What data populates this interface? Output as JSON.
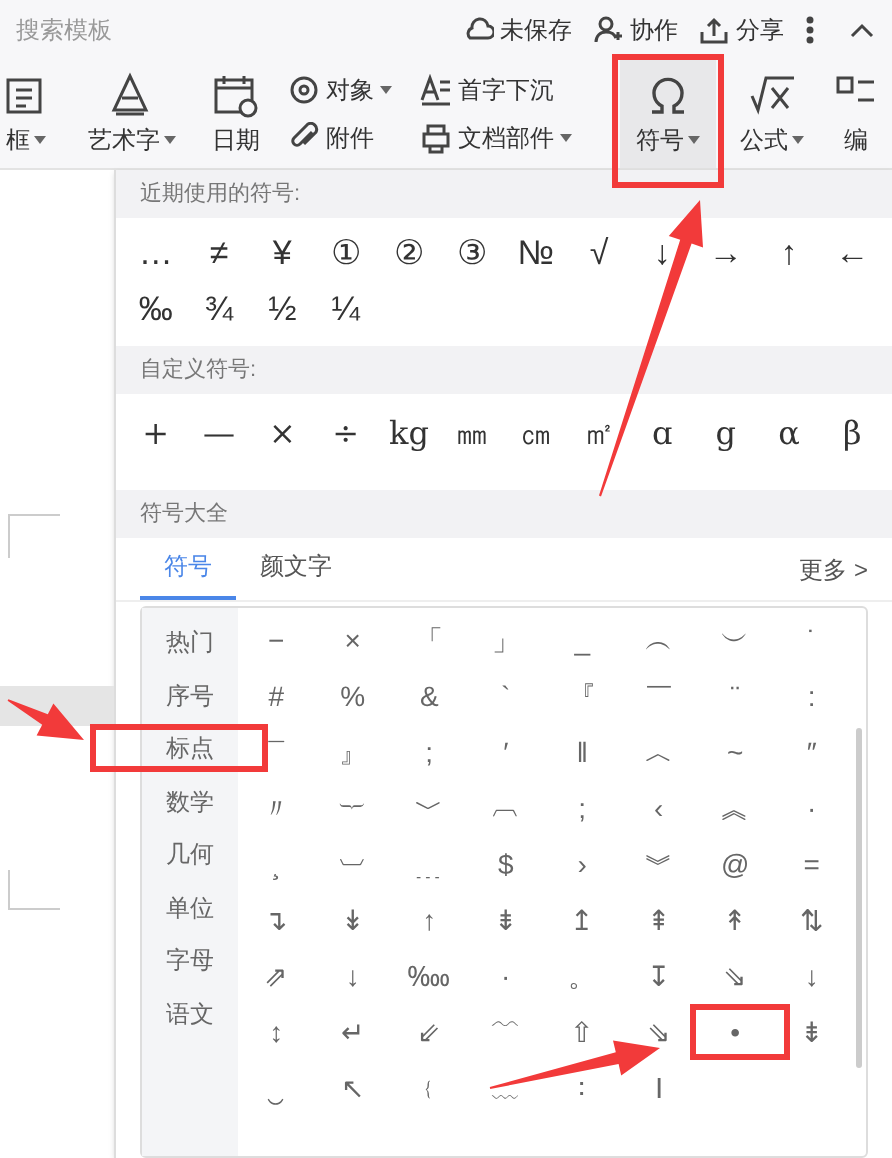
{
  "top_bar": {
    "search": "搜索模板",
    "actions": [
      {
        "label": "未保存"
      },
      {
        "label": "协作"
      },
      {
        "label": "分享"
      }
    ]
  },
  "toolbar": [
    {
      "kind": "large",
      "label": "框",
      "dropdown": true,
      "highlighted": false
    },
    {
      "kind": "large",
      "label": "艺术字",
      "dropdown": true,
      "highlighted": false
    },
    {
      "kind": "large",
      "label": "日期",
      "dropdown": false,
      "highlighted": false
    },
    {
      "kind": "pair",
      "items": [
        {
          "label": "对象",
          "dropdown": true
        },
        {
          "label": "附件",
          "dropdown": false
        }
      ]
    },
    {
      "kind": "pair",
      "items": [
        {
          "label": "首字下沉",
          "dropdown": false
        },
        {
          "label": "文档部件",
          "dropdown": true
        }
      ]
    },
    {
      "kind": "large",
      "label": "符号",
      "dropdown": true,
      "highlighted": true
    },
    {
      "kind": "large",
      "label": "公式",
      "dropdown": true,
      "highlighted": false
    },
    {
      "kind": "large",
      "label": "编",
      "dropdown": false,
      "highlighted": false
    }
  ],
  "symbol_panel": {
    "recent": {
      "title": "近期使用的符号:",
      "symbols": [
        "…",
        "≠",
        "¥",
        "①",
        "②",
        "③",
        "№",
        "√",
        "↓",
        "→",
        "↑",
        "←",
        "‰",
        "¾",
        "½",
        "¼"
      ]
    },
    "custom": {
      "title": "自定义符号:",
      "symbols": [
        "+",
        "—",
        "×",
        "÷",
        "kg",
        "㎜",
        "㎝",
        "㎡",
        "ɑ",
        "g",
        "α",
        "β"
      ]
    },
    "all": {
      "title": "符号大全",
      "tabs": [
        {
          "label": "符号",
          "selected": true
        },
        {
          "label": "颜文字",
          "selected": false
        }
      ],
      "more": "更多 >",
      "categories": [
        {
          "label": "热门",
          "highlighted": false
        },
        {
          "label": "序号",
          "highlighted": false
        },
        {
          "label": "标点",
          "highlighted": true
        },
        {
          "label": "数学",
          "highlighted": false
        },
        {
          "label": "几何",
          "highlighted": false
        },
        {
          "label": "单位",
          "highlighted": false
        },
        {
          "label": "字母",
          "highlighted": false
        },
        {
          "label": "语文",
          "highlighted": false
        }
      ],
      "symbols": [
        {
          "char": "−",
          "highlighted": false
        },
        {
          "char": "×",
          "highlighted": false
        },
        {
          "char": "「",
          "highlighted": false
        },
        {
          "char": "」",
          "highlighted": false
        },
        {
          "char": "_",
          "highlighted": false
        },
        {
          "char": "︵",
          "highlighted": false
        },
        {
          "char": "︶",
          "highlighted": false
        },
        {
          "char": "˙",
          "highlighted": false
        },
        {
          "char": "#",
          "highlighted": false
        },
        {
          "char": "%",
          "highlighted": false
        },
        {
          "char": "&",
          "highlighted": false
        },
        {
          "char": "`",
          "highlighted": false
        },
        {
          "char": "『",
          "highlighted": false
        },
        {
          "char": "￣",
          "highlighted": false
        },
        {
          "char": "¨",
          "highlighted": false
        },
        {
          "char": ":",
          "highlighted": false
        },
        {
          "char": "¯",
          "highlighted": false
        },
        {
          "char": "』",
          "highlighted": false
        },
        {
          "char": ";",
          "highlighted": false
        },
        {
          "char": "′",
          "highlighted": false
        },
        {
          "char": "‖",
          "highlighted": false
        },
        {
          "char": "︿",
          "highlighted": false
        },
        {
          "char": "~",
          "highlighted": false
        },
        {
          "char": "″",
          "highlighted": false
        },
        {
          "char": "〃",
          "highlighted": false
        },
        {
          "char": "︸",
          "highlighted": false
        },
        {
          "char": "﹀",
          "highlighted": false
        },
        {
          "char": "︹",
          "highlighted": false
        },
        {
          "char": ";",
          "highlighted": false
        },
        {
          "char": "‹",
          "highlighted": false
        },
        {
          "char": "︽",
          "highlighted": false
        },
        {
          "char": "·",
          "highlighted": false
        },
        {
          "char": "¸",
          "highlighted": false
        },
        {
          "char": "︺",
          "highlighted": false
        },
        {
          "char": "﹍",
          "highlighted": false
        },
        {
          "char": "$",
          "highlighted": false
        },
        {
          "char": "›",
          "highlighted": false
        },
        {
          "char": "︾",
          "highlighted": false
        },
        {
          "char": "@",
          "highlighted": false
        },
        {
          "char": "=",
          "highlighted": false
        },
        {
          "char": "↴",
          "highlighted": false
        },
        {
          "char": "↡",
          "highlighted": false
        },
        {
          "char": "↑",
          "highlighted": false
        },
        {
          "char": "⇟",
          "highlighted": false
        },
        {
          "char": "↥",
          "highlighted": false
        },
        {
          "char": "⇞",
          "highlighted": false
        },
        {
          "char": "↟",
          "highlighted": false
        },
        {
          "char": "⇅",
          "highlighted": false
        },
        {
          "char": "⇗",
          "highlighted": false
        },
        {
          "char": "↓",
          "highlighted": false
        },
        {
          "char": "‱",
          "highlighted": false
        },
        {
          "char": "·",
          "highlighted": false
        },
        {
          "char": "。",
          "highlighted": false
        },
        {
          "char": "↧",
          "highlighted": false
        },
        {
          "char": "⇘",
          "highlighted": false
        },
        {
          "char": "↓",
          "highlighted": false
        },
        {
          "char": "↕",
          "highlighted": false
        },
        {
          "char": "↵",
          "highlighted": false
        },
        {
          "char": "⇙",
          "highlighted": false
        },
        {
          "char": "﹋",
          "highlighted": false
        },
        {
          "char": "⇧",
          "highlighted": false
        },
        {
          "char": "⇘",
          "highlighted": false
        },
        {
          "char": "•",
          "highlighted": true
        },
        {
          "char": "⇟",
          "highlighted": false
        },
        {
          "char": "‿",
          "highlighted": false
        },
        {
          "char": "↖",
          "highlighted": false
        },
        {
          "char": "﹛",
          "highlighted": false
        },
        {
          "char": "﹏",
          "highlighted": false
        },
        {
          "char": "∶",
          "highlighted": false
        },
        {
          "char": "Ⅰ",
          "highlighted": false
        }
      ]
    }
  }
}
